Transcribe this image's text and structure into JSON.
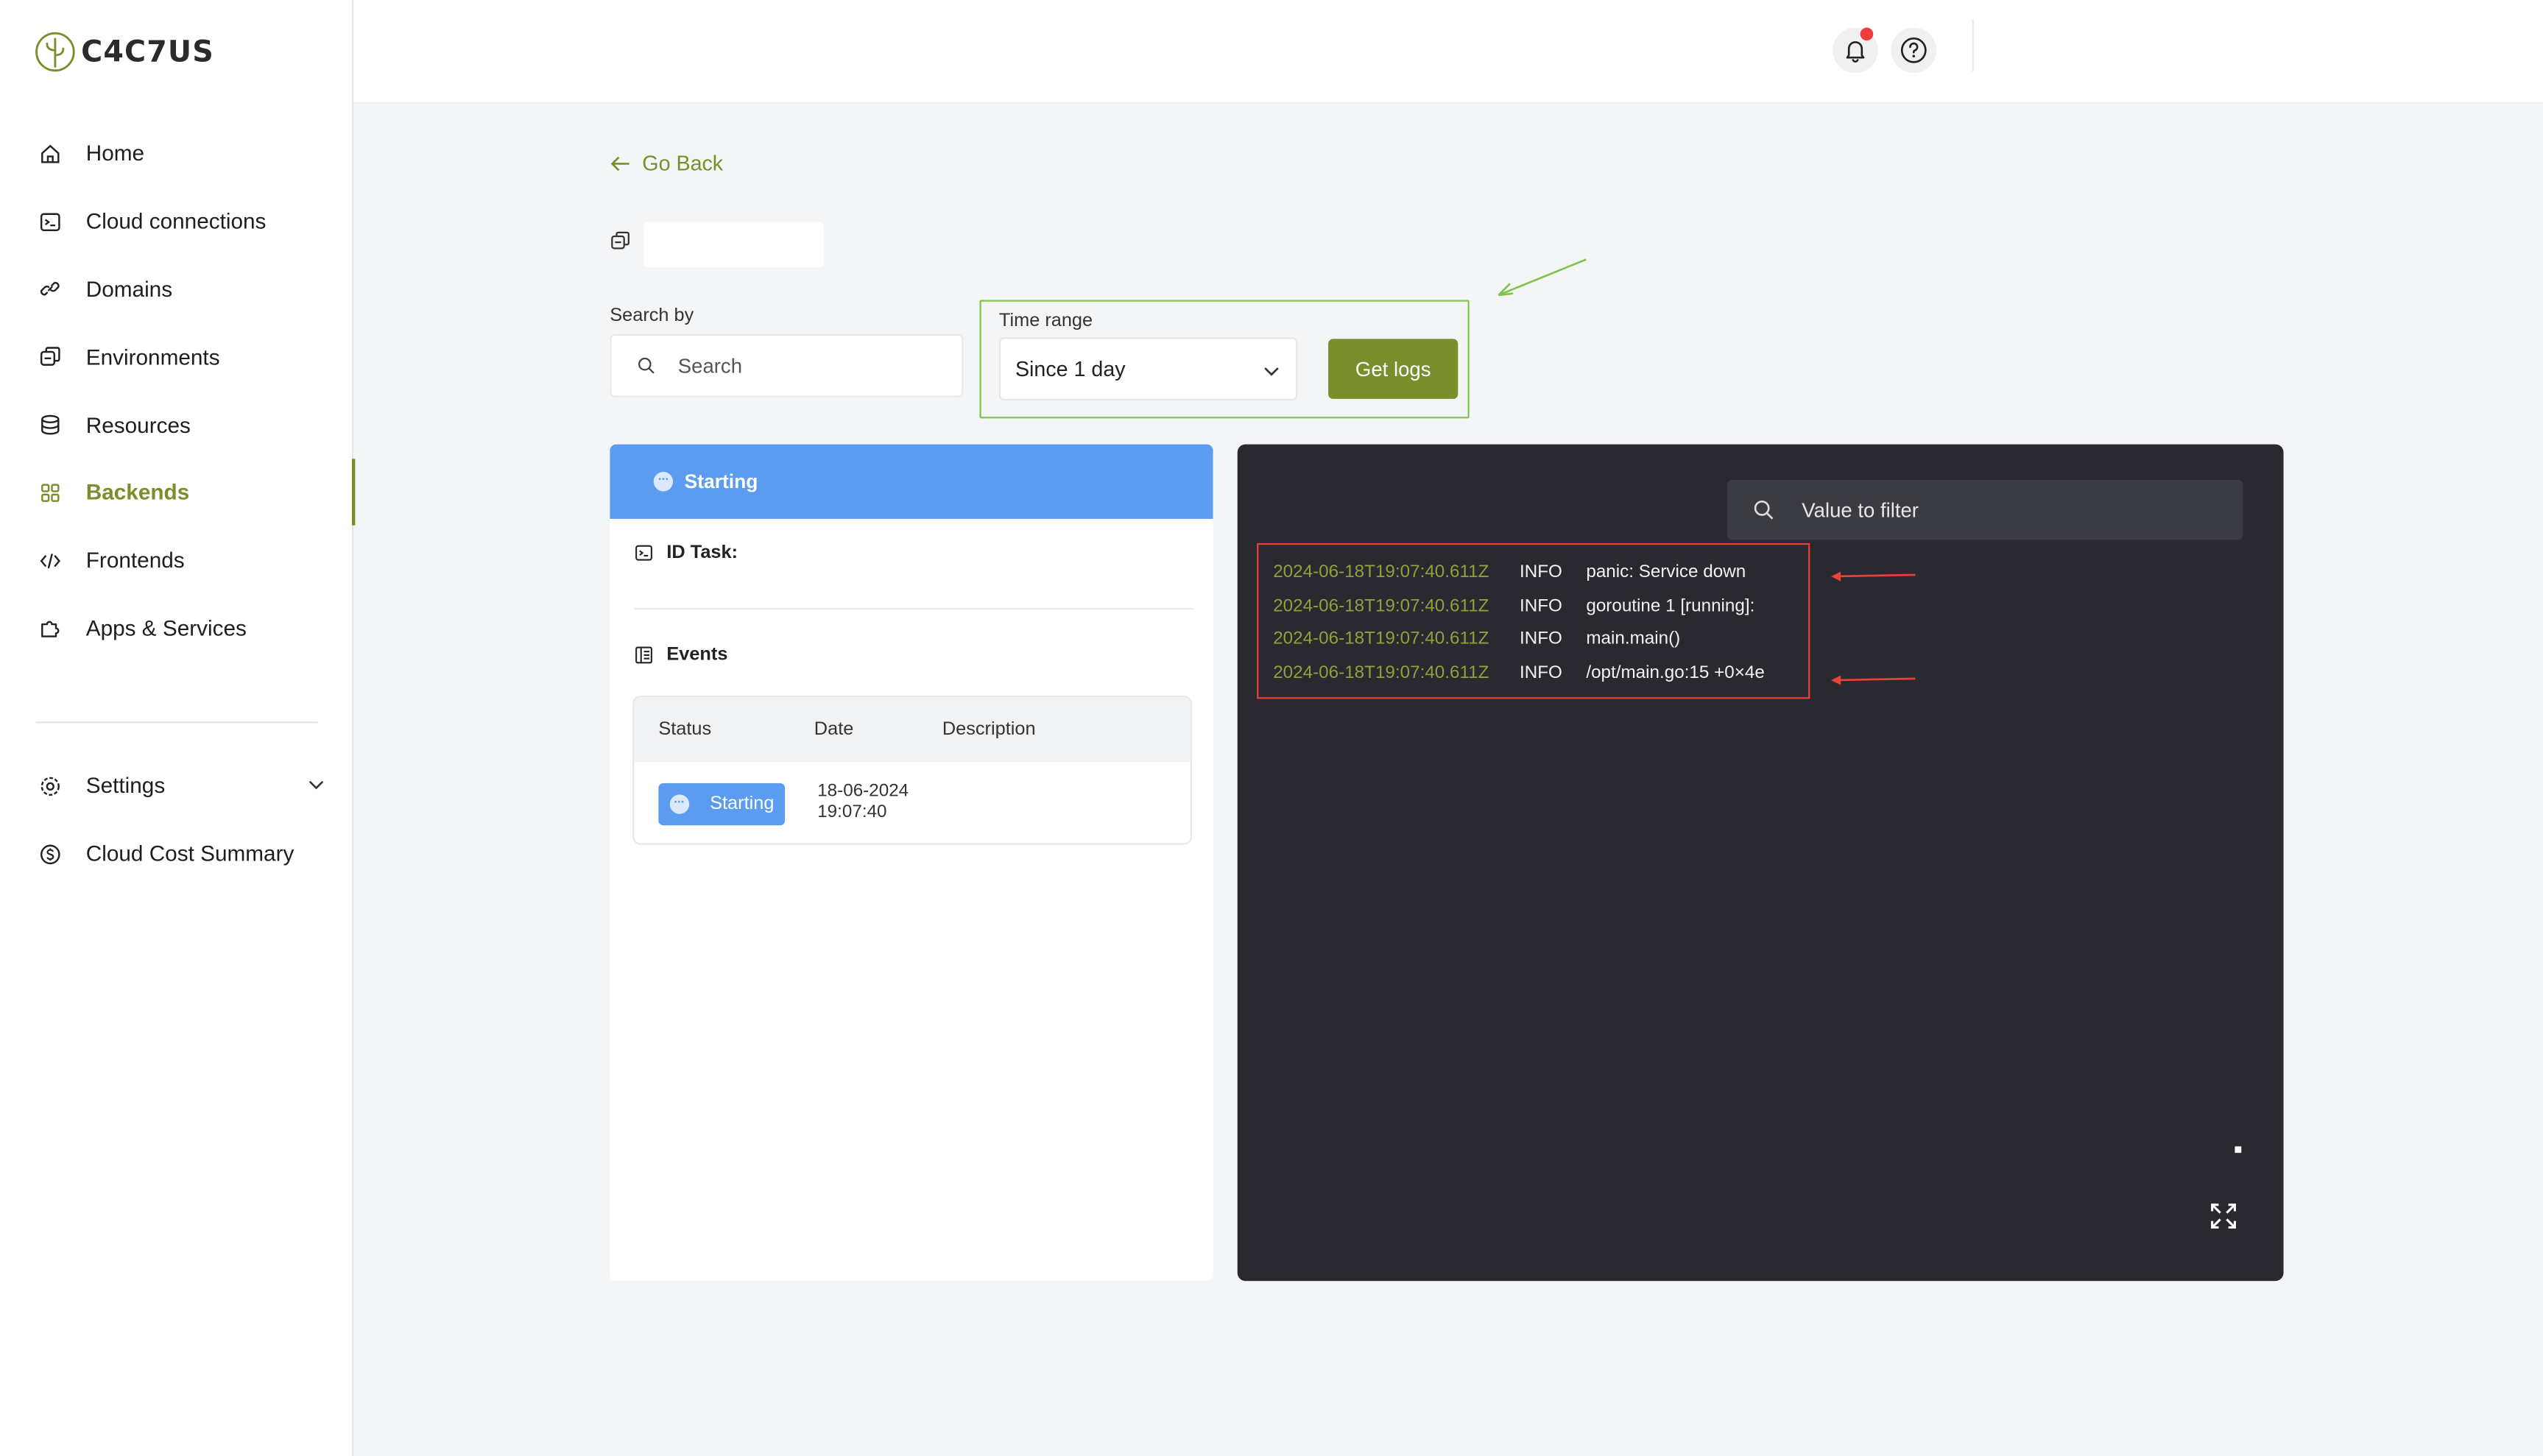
{
  "brand": {
    "name": "C4C7US",
    "accent": "#7a8e2c"
  },
  "sidebar": {
    "items": [
      {
        "label": "Home",
        "icon": "home-icon"
      },
      {
        "label": "Cloud connections",
        "icon": "terminal-icon"
      },
      {
        "label": "Domains",
        "icon": "link-icon"
      },
      {
        "label": "Environments",
        "icon": "environment-icon"
      },
      {
        "label": "Resources",
        "icon": "database-icon"
      },
      {
        "label": "Backends",
        "icon": "grid-icon",
        "active": true
      },
      {
        "label": "Frontends",
        "icon": "code-icon"
      },
      {
        "label": "Apps & Services",
        "icon": "puzzle-icon"
      }
    ],
    "secondary": [
      {
        "label": "Settings",
        "icon": "gear-icon"
      },
      {
        "label": "Cloud Cost Summary",
        "icon": "dollar-icon"
      }
    ]
  },
  "header": {
    "notifications": "bell-icon",
    "help": "help-icon"
  },
  "page": {
    "go_back": "Go Back",
    "search": {
      "label": "Search by",
      "placeholder": "Search"
    },
    "time_range": {
      "label": "Time range",
      "selected": "Since 1 day",
      "button": "Get logs"
    }
  },
  "task": {
    "status": "Starting",
    "id_label": "ID Task:",
    "events_title": "Events",
    "columns": [
      "Status",
      "Date",
      "Description"
    ],
    "events": [
      {
        "status": "Starting",
        "date_line1": "18-06-2024",
        "date_line2": "19:07:40",
        "description": ""
      }
    ]
  },
  "logs": {
    "filter_placeholder": "Value to filter",
    "lines": [
      {
        "ts": "2024-06-18T19:07:40.611Z",
        "level": "INFO",
        "msg": "panic: Service down"
      },
      {
        "ts": "2024-06-18T19:07:40.611Z",
        "level": "INFO",
        "msg": "goroutine 1 [running]:"
      },
      {
        "ts": "2024-06-18T19:07:40.611Z",
        "level": "INFO",
        "msg": "main.main()"
      },
      {
        "ts": "2024-06-18T19:07:40.611Z",
        "level": "INFO",
        "msg": "/opt/main.go:15 +0×4e"
      }
    ]
  }
}
